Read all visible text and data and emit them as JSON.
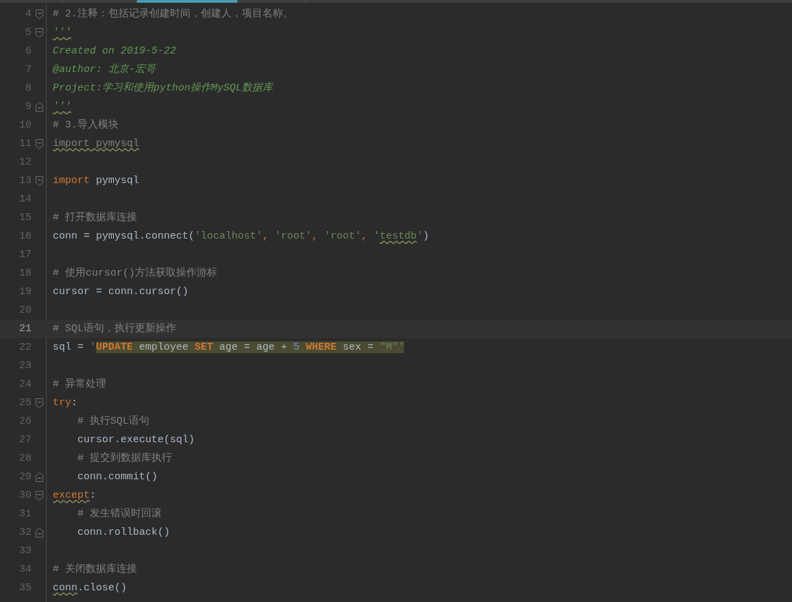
{
  "tabs": [
    {
      "selected": false
    },
    {
      "selected": false
    },
    {
      "selected": true
    },
    {
      "selected": false
    }
  ],
  "lines": [
    {
      "number": "4",
      "fold_open": true,
      "tokens": [
        {
          "t": "# 2.注释：包括记录创建时间，创建人，项目名称。",
          "kind": "comment"
        }
      ]
    },
    {
      "number": "5",
      "fold_open": true,
      "tokens": [
        {
          "t": "'''",
          "kind": "doc",
          "sq": true
        }
      ]
    },
    {
      "number": "6",
      "tokens": [
        {
          "t": "Created on 2019-5-22",
          "kind": "doc"
        }
      ]
    },
    {
      "number": "7",
      "tokens": [
        {
          "t": "@author: 北京-宏哥",
          "kind": "doc"
        }
      ]
    },
    {
      "number": "8",
      "tokens": [
        {
          "t": "Project:学习和使用python操作MySQL数据库",
          "kind": "doc"
        }
      ]
    },
    {
      "number": "9",
      "fold_close": true,
      "tokens": [
        {
          "t": "'''",
          "kind": "doc",
          "sq": true
        }
      ]
    },
    {
      "number": "10",
      "tokens": [
        {
          "t": "# 3.导入模块",
          "kind": "comment"
        }
      ]
    },
    {
      "number": "11",
      "fold_open": true,
      "tokens": [
        {
          "t": "import pymysql",
          "kind": "unused",
          "sq": true
        }
      ]
    },
    {
      "number": "12"
    },
    {
      "number": "13",
      "fold_open": true,
      "tokens": [
        {
          "t": "import",
          "kind": "keyword"
        },
        {
          "t": " pymysql",
          "kind": "plain"
        }
      ]
    },
    {
      "number": "14"
    },
    {
      "number": "15",
      "tokens": [
        {
          "t": "# 打开数据库连接",
          "kind": "comment"
        }
      ]
    },
    {
      "number": "16",
      "tokens": [
        {
          "t": "conn = pymysql.connect(",
          "kind": "plain"
        },
        {
          "t": "'localhost'",
          "kind": "string"
        },
        {
          "t": ", ",
          "kind": "keyword"
        },
        {
          "t": "'root'",
          "kind": "string"
        },
        {
          "t": ", ",
          "kind": "keyword"
        },
        {
          "t": "'root'",
          "kind": "string"
        },
        {
          "t": ", ",
          "kind": "keyword"
        },
        {
          "t": "'",
          "kind": "string"
        },
        {
          "t": "testdb",
          "kind": "string",
          "sq": true
        },
        {
          "t": "'",
          "kind": "string"
        },
        {
          "t": ")",
          "kind": "plain"
        }
      ]
    },
    {
      "number": "17"
    },
    {
      "number": "18",
      "tokens": [
        {
          "t": "# 使用cursor()方法获取操作游标",
          "kind": "comment"
        }
      ]
    },
    {
      "number": "19",
      "tokens": [
        {
          "t": "cursor = conn.cursor()",
          "kind": "plain"
        }
      ]
    },
    {
      "number": "20"
    },
    {
      "number": "21",
      "current": true,
      "tokens": [
        {
          "t": "# SQL语句，执行更新操作",
          "kind": "comment"
        }
      ]
    },
    {
      "number": "22",
      "tokens": [
        {
          "t": "sql = ",
          "kind": "plain"
        },
        {
          "t": "'",
          "kind": "string"
        },
        {
          "t": "UPDATE",
          "kind": "sql",
          "hl": true
        },
        {
          "t": " employee ",
          "kind": "plain",
          "hl": true
        },
        {
          "t": "SET",
          "kind": "sql",
          "hl": true
        },
        {
          "t": " age = age + ",
          "kind": "plain",
          "hl": true
        },
        {
          "t": "5 ",
          "kind": "number",
          "hl": true
        },
        {
          "t": "WHERE",
          "kind": "sql",
          "hl": true
        },
        {
          "t": " sex = ",
          "kind": "plain",
          "hl": true
        },
        {
          "t": "\"M\"'",
          "kind": "string",
          "hl": true
        }
      ]
    },
    {
      "number": "23"
    },
    {
      "number": "24",
      "tokens": [
        {
          "t": "# 异常处理",
          "kind": "comment"
        }
      ]
    },
    {
      "number": "25",
      "fold_open": true,
      "tokens": [
        {
          "t": "try",
          "kind": "keyword"
        },
        {
          "t": ":",
          "kind": "plain"
        }
      ]
    },
    {
      "number": "26",
      "tokens": [
        {
          "t": "    # 执行SQL语句",
          "kind": "comment"
        }
      ]
    },
    {
      "number": "27",
      "tokens": [
        {
          "t": "    cursor.execute(sql)",
          "kind": "plain"
        }
      ]
    },
    {
      "number": "28",
      "tokens": [
        {
          "t": "    # 提交到数据库执行",
          "kind": "comment"
        }
      ]
    },
    {
      "number": "29",
      "fold_close": true,
      "tokens": [
        {
          "t": "    conn.commit()",
          "kind": "plain"
        }
      ]
    },
    {
      "number": "30",
      "fold_open": true,
      "tokens": [
        {
          "t": "except",
          "kind": "keyword",
          "sq": true
        },
        {
          "t": ":",
          "kind": "plain"
        }
      ]
    },
    {
      "number": "31",
      "tokens": [
        {
          "t": "    # 发生错误时回滚",
          "kind": "comment"
        }
      ]
    },
    {
      "number": "32",
      "fold_close": true,
      "tokens": [
        {
          "t": "    conn.rollback()",
          "kind": "plain"
        }
      ]
    },
    {
      "number": "33"
    },
    {
      "number": "34",
      "tokens": [
        {
          "t": "# 关闭数据库连接",
          "kind": "comment"
        }
      ]
    },
    {
      "number": "35",
      "tokens": [
        {
          "t": "conn",
          "kind": "plain",
          "sq": true
        },
        {
          "t": ".close()",
          "kind": "plain"
        }
      ]
    }
  ]
}
